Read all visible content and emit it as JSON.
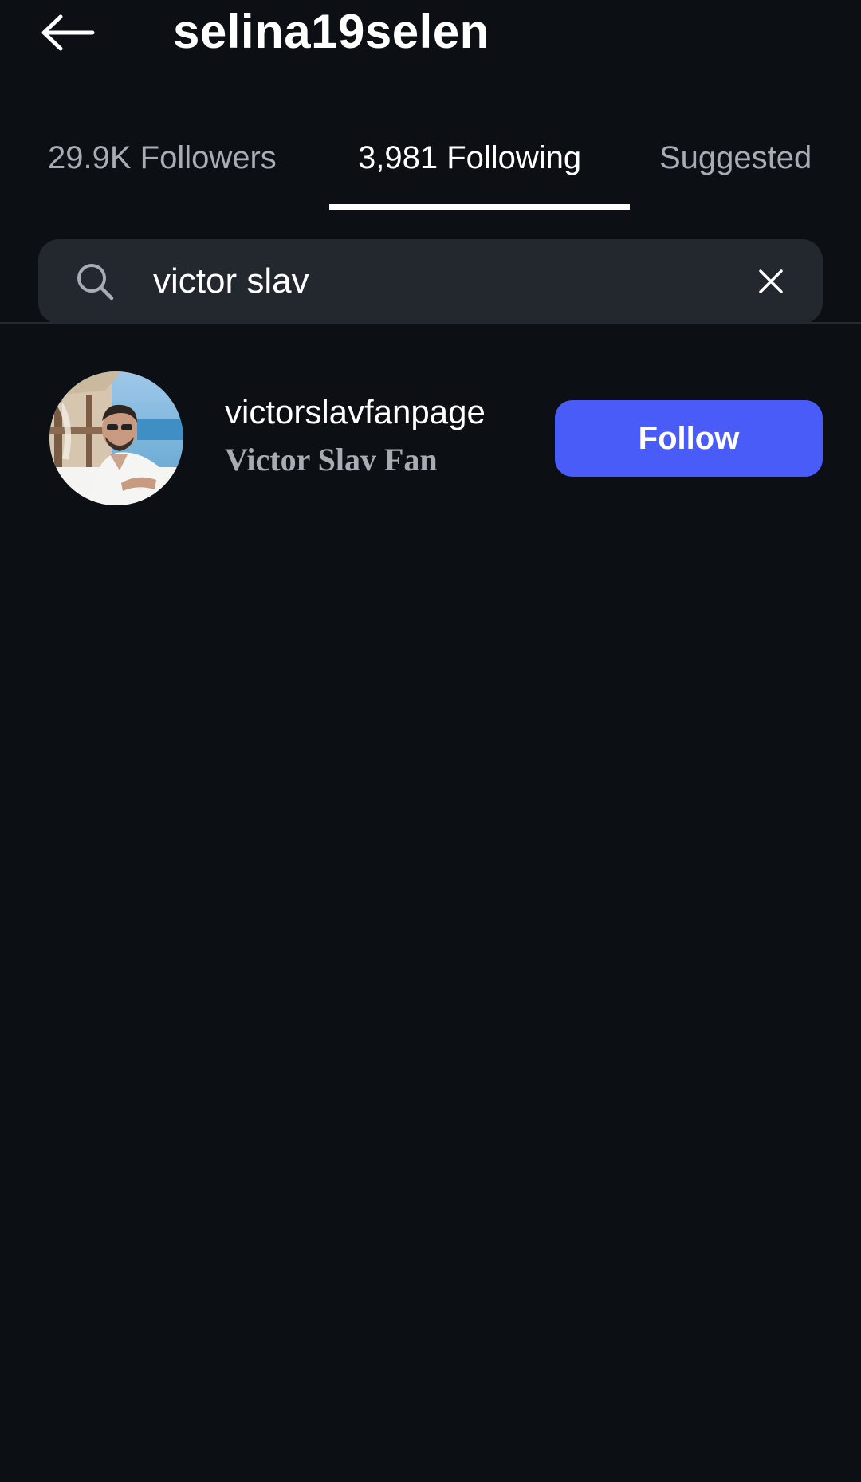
{
  "header": {
    "title": "selina19selen",
    "back_icon": "arrow-left-icon"
  },
  "tabs": [
    {
      "label": "29.9K Followers",
      "active": false
    },
    {
      "label": "3,981 Following",
      "active": true
    },
    {
      "label": "Suggested",
      "active": false
    }
  ],
  "search": {
    "value": "victor slav",
    "icon": "search-icon",
    "clear_icon": "close-icon"
  },
  "results": [
    {
      "username": "victorslavfanpage",
      "full_name": "Victor Slav Fan",
      "action_label": "Follow"
    }
  ],
  "colors": {
    "background": "#0c0f14",
    "search_background": "#23272e",
    "follow_button": "#4a5cf7",
    "inactive_tab_text": "#a8adb5",
    "secondary_text": "#a9acb2"
  }
}
